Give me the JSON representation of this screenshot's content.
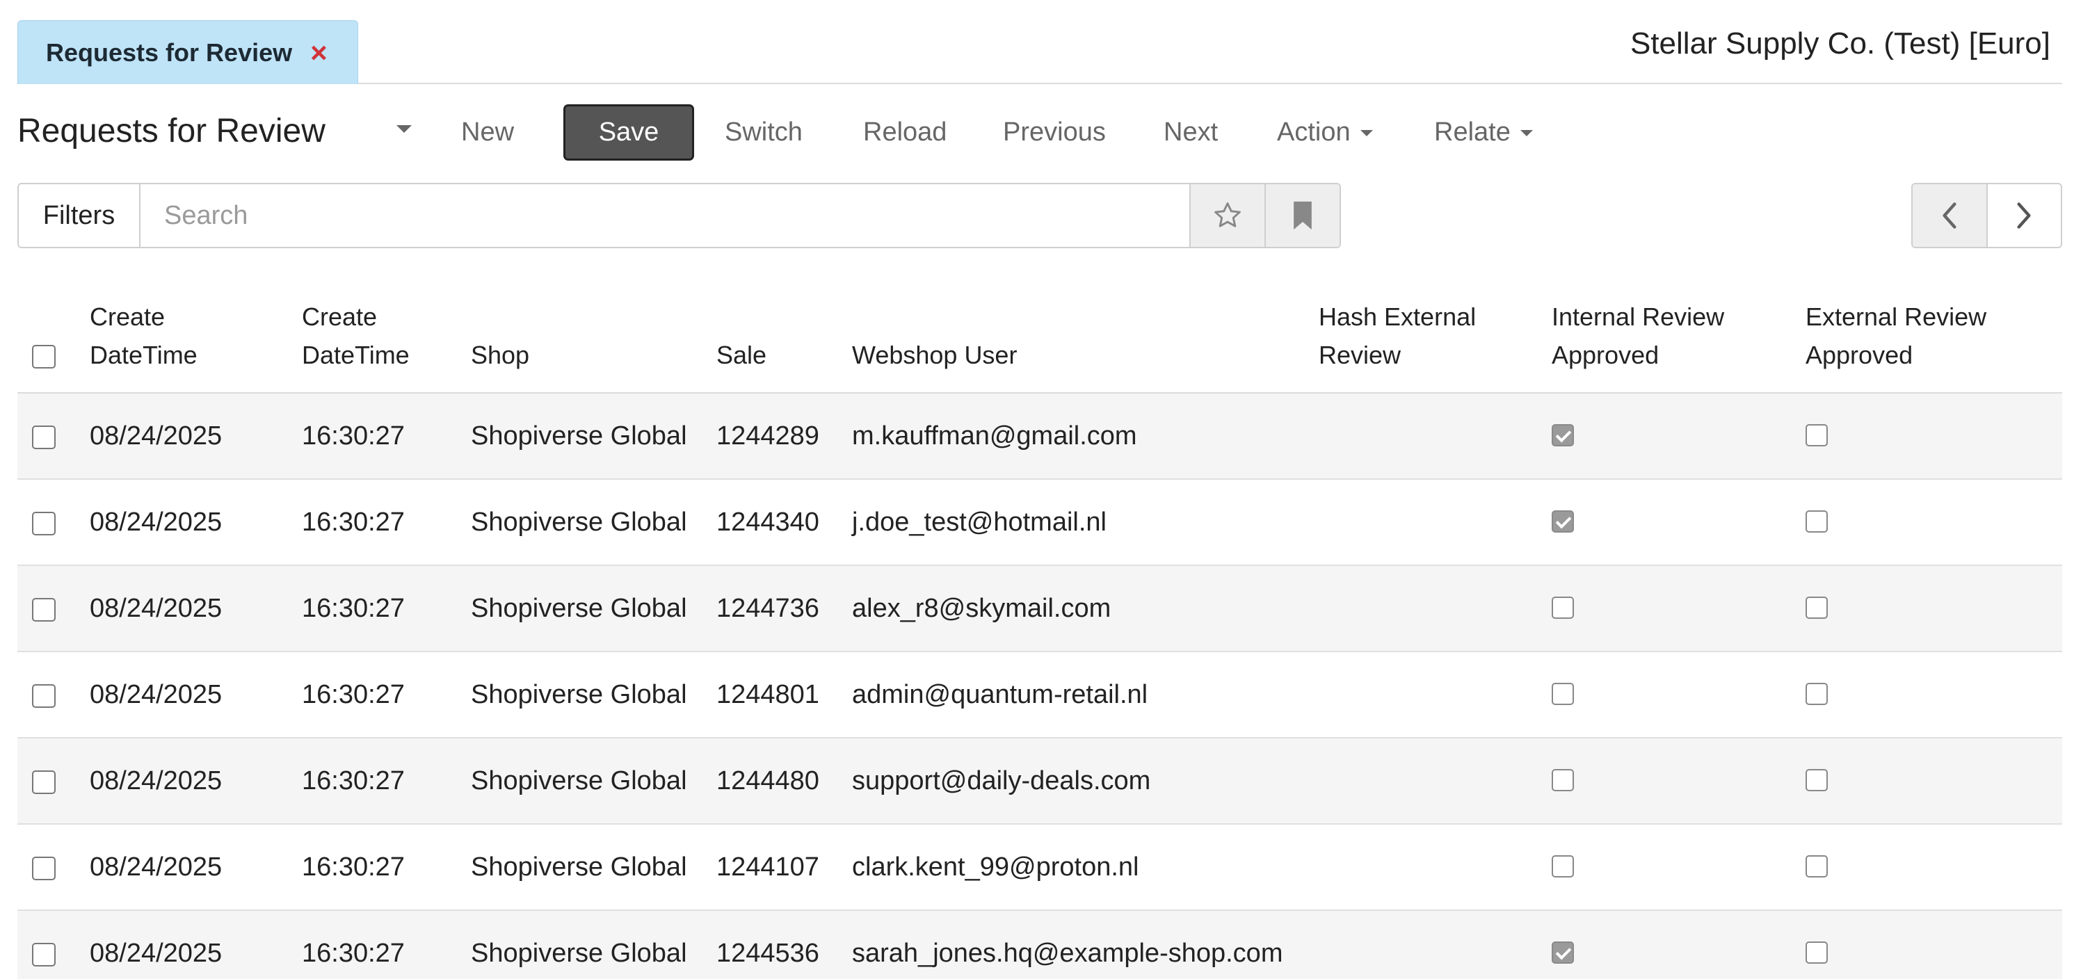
{
  "tab": {
    "label": "Requests for Review",
    "close_symbol": "×"
  },
  "company": "Stellar Supply Co. (Test) [Euro]",
  "toolbar": {
    "title": "Requests for Review",
    "new": "New",
    "save": "Save",
    "switch": "Switch",
    "reload": "Reload",
    "previous": "Previous",
    "next": "Next",
    "action": "Action",
    "relate": "Relate"
  },
  "filters": {
    "label": "Filters",
    "search_placeholder": "Search",
    "search_value": ""
  },
  "icons": {
    "title_dropdown": "chevron-down-icon",
    "favorite": "star-icon",
    "bookmark": "bookmark-icon",
    "prev_page": "chevron-left-icon",
    "next_page": "chevron-right-icon"
  },
  "colors": {
    "tab_bg": "#bfe3f7",
    "tab_close": "#d0333a",
    "save_bg": "#555555",
    "checked_box": "#9a9a9a"
  },
  "table": {
    "headers": {
      "create_date": [
        "Create",
        "DateTime"
      ],
      "create_time": [
        "Create",
        "DateTime"
      ],
      "shop": "Shop",
      "sale": "Sale",
      "webshop_user": "Webshop User",
      "hash_external_review": [
        "Hash External",
        "Review"
      ],
      "internal_review_approved": [
        "Internal Review",
        "Approved"
      ],
      "external_review_approved": [
        "External Review",
        "Approved"
      ]
    },
    "rows": [
      {
        "date": "08/24/2025",
        "time": "16:30:27",
        "shop": "Shopiverse Global",
        "sale": "1244289",
        "user": "m.kauffman@gmail.com",
        "hash": "",
        "internal": true,
        "external": false
      },
      {
        "date": "08/24/2025",
        "time": "16:30:27",
        "shop": "Shopiverse Global",
        "sale": "1244340",
        "user": "j.doe_test@hotmail.nl",
        "hash": "",
        "internal": true,
        "external": false
      },
      {
        "date": "08/24/2025",
        "time": "16:30:27",
        "shop": "Shopiverse Global",
        "sale": "1244736",
        "user": "alex_r8@skymail.com",
        "hash": "",
        "internal": false,
        "external": false
      },
      {
        "date": "08/24/2025",
        "time": "16:30:27",
        "shop": "Shopiverse Global",
        "sale": "1244801",
        "user": "admin@quantum-retail.nl",
        "hash": "",
        "internal": false,
        "external": false
      },
      {
        "date": "08/24/2025",
        "time": "16:30:27",
        "shop": "Shopiverse Global",
        "sale": "1244480",
        "user": "support@daily-deals.com",
        "hash": "",
        "internal": false,
        "external": false
      },
      {
        "date": "08/24/2025",
        "time": "16:30:27",
        "shop": "Shopiverse Global",
        "sale": "1244107",
        "user": "clark.kent_99@proton.nl",
        "hash": "",
        "internal": false,
        "external": false
      },
      {
        "date": "08/24/2025",
        "time": "16:30:27",
        "shop": "Shopiverse Global",
        "sale": "1244536",
        "user": "sarah_jones.hq@example-shop.com",
        "hash": "",
        "internal": true,
        "external": false
      }
    ]
  }
}
